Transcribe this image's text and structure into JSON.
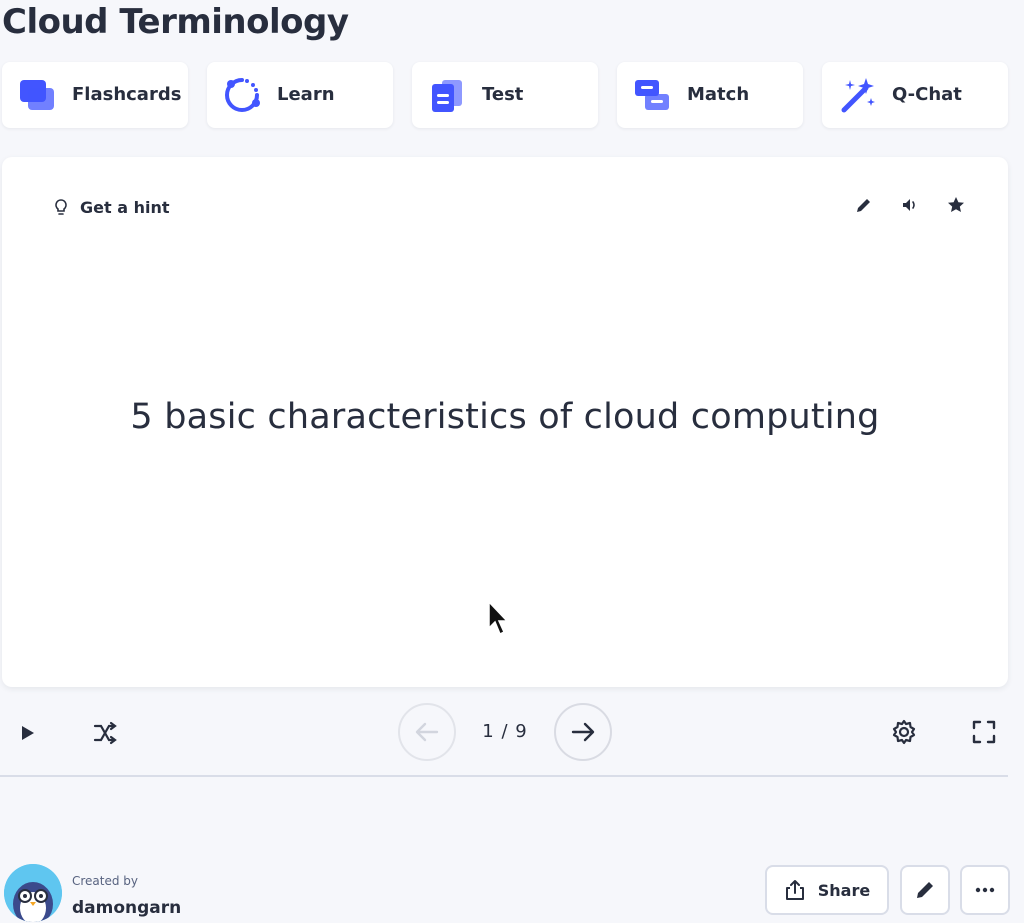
{
  "page": {
    "title": "Cloud Terminology"
  },
  "modes": [
    {
      "label": "Flashcards",
      "icon": "flashcards-icon"
    },
    {
      "label": "Learn",
      "icon": "learn-icon"
    },
    {
      "label": "Test",
      "icon": "test-icon"
    },
    {
      "label": "Match",
      "icon": "match-icon"
    },
    {
      "label": "Q-Chat",
      "icon": "magic-wand-icon"
    }
  ],
  "card": {
    "hint_label": "Get a hint",
    "term": "5 basic characteristics of cloud computing",
    "tools": [
      "edit-icon",
      "audio-icon",
      "star-icon"
    ]
  },
  "controls": {
    "counter": "1 / 9",
    "icons": [
      "play-icon",
      "shuffle-icon",
      "arrow-left-icon",
      "arrow-right-icon",
      "settings-icon",
      "fullscreen-icon"
    ]
  },
  "footer": {
    "created_label": "Created by",
    "creator": "damongarn",
    "share_label": "Share"
  },
  "colors": {
    "background": "#f6f7fb",
    "accent": "#4255ff",
    "text": "#282e3e"
  }
}
